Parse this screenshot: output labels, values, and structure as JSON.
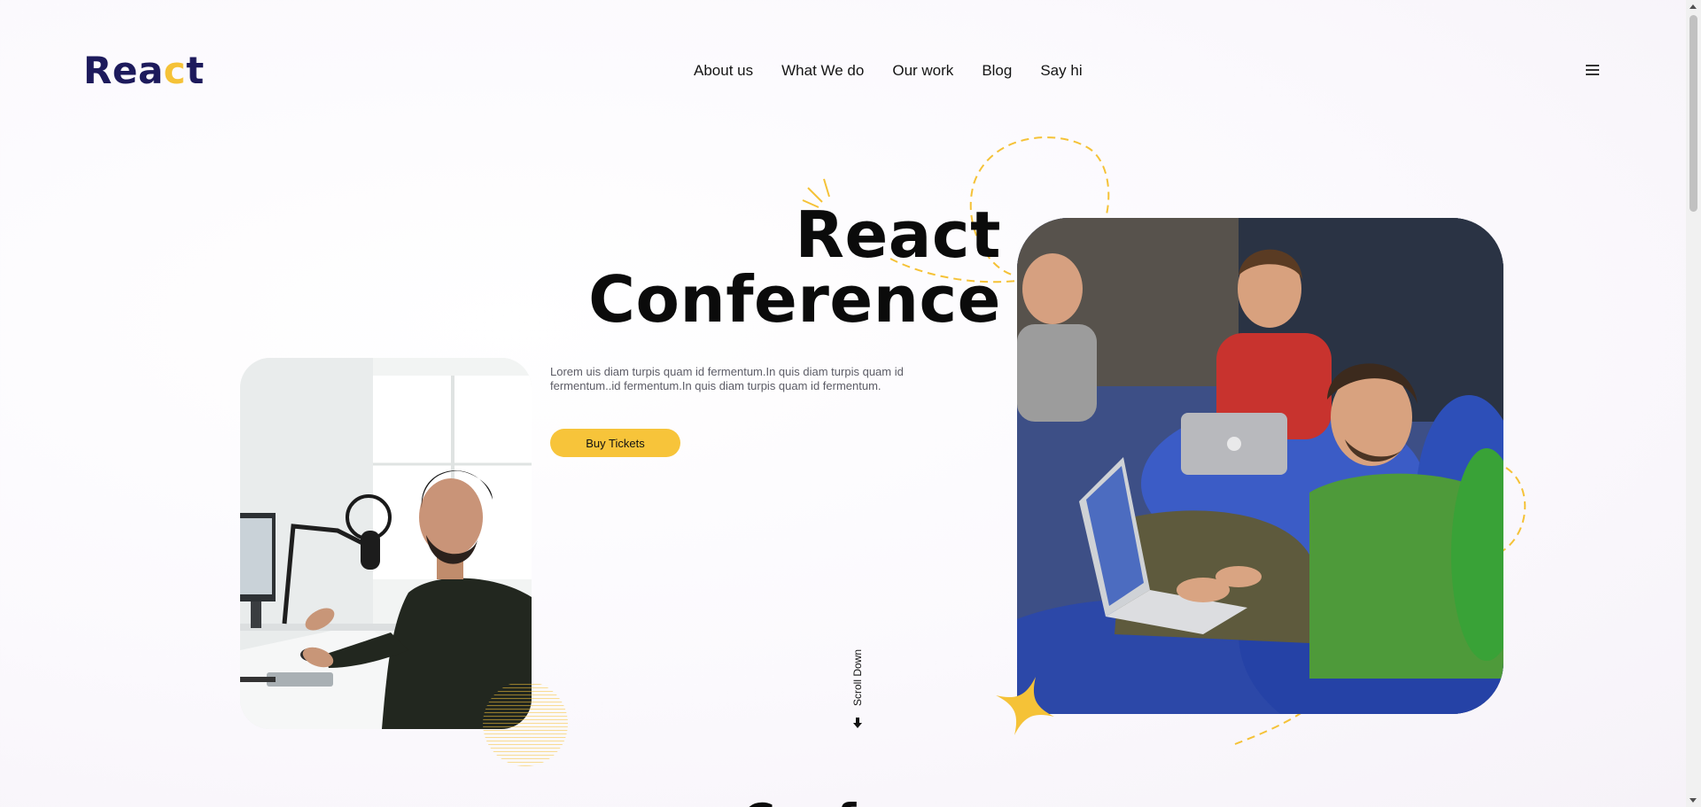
{
  "header": {
    "logo_start": "Rea",
    "logo_accent": "c",
    "logo_end": "t",
    "nav": [
      {
        "label": "About us"
      },
      {
        "label": "What We do"
      },
      {
        "label": "Our work"
      },
      {
        "label": "Blog"
      },
      {
        "label": "Say hi"
      }
    ],
    "menu_icon": "hamburger-menu-icon"
  },
  "hero": {
    "title_line1": "React",
    "title_line2": "Conference",
    "description": "Lorem uis diam turpis quam id fermentum.In quis diam turpis quam id fermentum..id fermentum.In quis diam turpis quam id fermentum.",
    "cta_label": "Buy Tickets",
    "scroll_label": "Scroll Down",
    "scroll_icon": "arrow-down-icon",
    "left_photo": "man-with-microphone-photo",
    "right_photo": "people-with-laptops-on-beanbags-photo"
  },
  "next_section": {
    "heading_partial": "Conf"
  },
  "colors": {
    "brand_navy": "#1d1a5c",
    "accent_yellow": "#f7c43a",
    "text_dark": "#0b0b0b"
  }
}
